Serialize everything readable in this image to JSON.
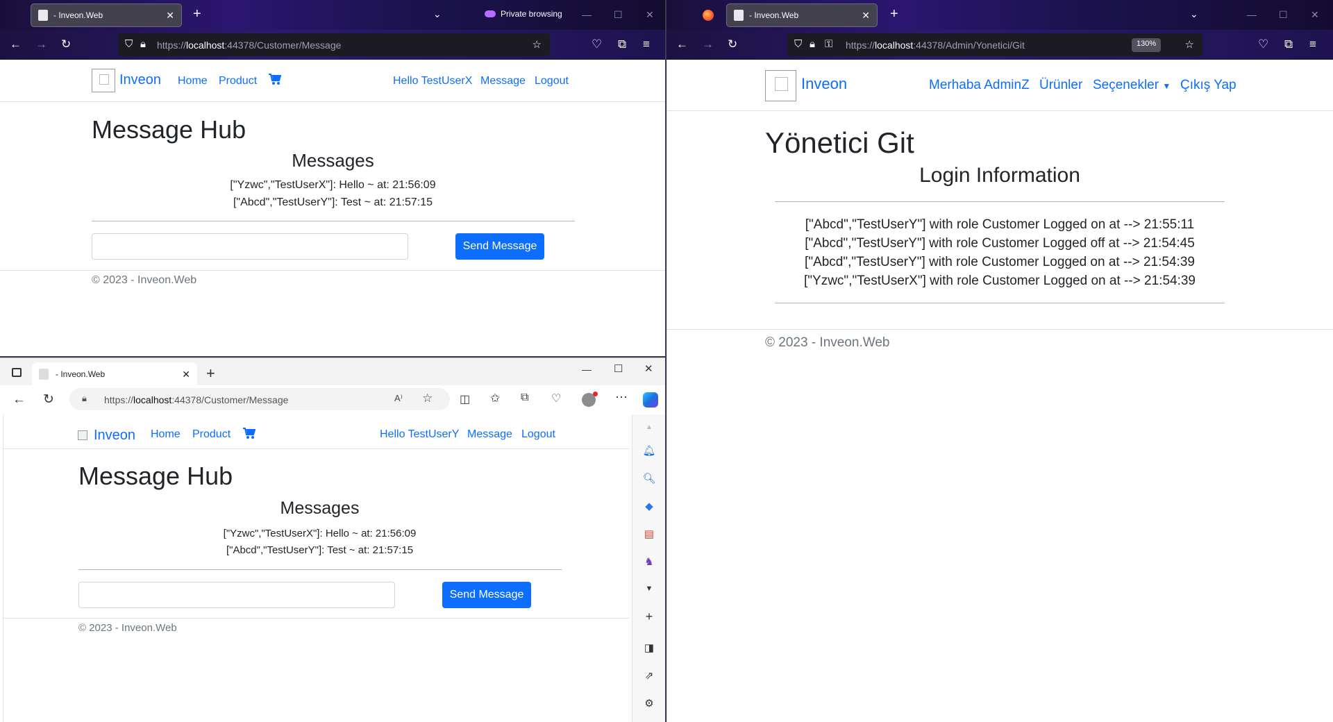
{
  "left_top_window": {
    "browser": "Firefox",
    "tab_title": "- Inveon.Web",
    "private_label": "Private browsing",
    "url_prefix": "https://",
    "url_host": "localhost",
    "url_rest": ":44378/Customer/Message",
    "page": {
      "brand": "Inveon",
      "nav": {
        "home": "Home",
        "product": "Product",
        "hello": "Hello TestUserX",
        "message": "Message",
        "logout": "Logout"
      },
      "title": "Message Hub",
      "subtitle": "Messages",
      "messages": [
        "[\"Yzwc\",\"TestUserX\"]: Hello ~ at: 21:56:09",
        "[\"Abcd\",\"TestUserY\"]: Test ~ at: 21:57:15"
      ],
      "input_value": "",
      "send_label": "Send Message",
      "footer": "© 2023 - Inveon.Web"
    }
  },
  "right_window": {
    "browser": "Firefox",
    "tab_title": "- Inveon.Web",
    "url_prefix": "https://",
    "url_host": "localhost",
    "url_rest": ":44378/Admin/Yonetici/Git",
    "zoom": "130%",
    "page": {
      "brand": "Inveon",
      "nav": {
        "hello": "Merhaba AdminZ",
        "products": "Ürünler",
        "options": "Seçenekler",
        "logout": "Çıkış Yap"
      },
      "title": "Yönetici Git",
      "subtitle": "Login Information",
      "logins": [
        "[\"Abcd\",\"TestUserY\"] with role Customer Logged on at --> 21:55:11",
        "[\"Abcd\",\"TestUserY\"] with role Customer Logged off at --> 21:54:45",
        "[\"Abcd\",\"TestUserY\"] with role Customer Logged on at --> 21:54:39",
        "[\"Yzwc\",\"TestUserX\"] with role Customer Logged on at --> 21:54:39"
      ],
      "footer": "© 2023 - Inveon.Web"
    }
  },
  "left_bottom_window": {
    "browser": "Edge",
    "tab_title": "- Inveon.Web",
    "url_prefix": "https://",
    "url_host": "localhost",
    "url_rest": ":44378/Customer/Message",
    "page": {
      "brand": "Inveon",
      "nav": {
        "home": "Home",
        "product": "Product",
        "hello": "Hello TestUserY",
        "message": "Message",
        "logout": "Logout"
      },
      "title": "Message Hub",
      "subtitle": "Messages",
      "messages": [
        "[\"Yzwc\",\"TestUserX\"]: Hello ~ at: 21:56:09",
        "[\"Abcd\",\"TestUserY\"]: Test ~ at: 21:57:15"
      ],
      "input_value": "",
      "send_label": "Send Message",
      "footer": "© 2023 - Inveon.Web"
    }
  },
  "colors": {
    "link": "#0d6efd",
    "button": "#0d6efd",
    "firefox_toolbar": "#2b1a6c",
    "edge_toolbar": "#f3f3f3"
  }
}
